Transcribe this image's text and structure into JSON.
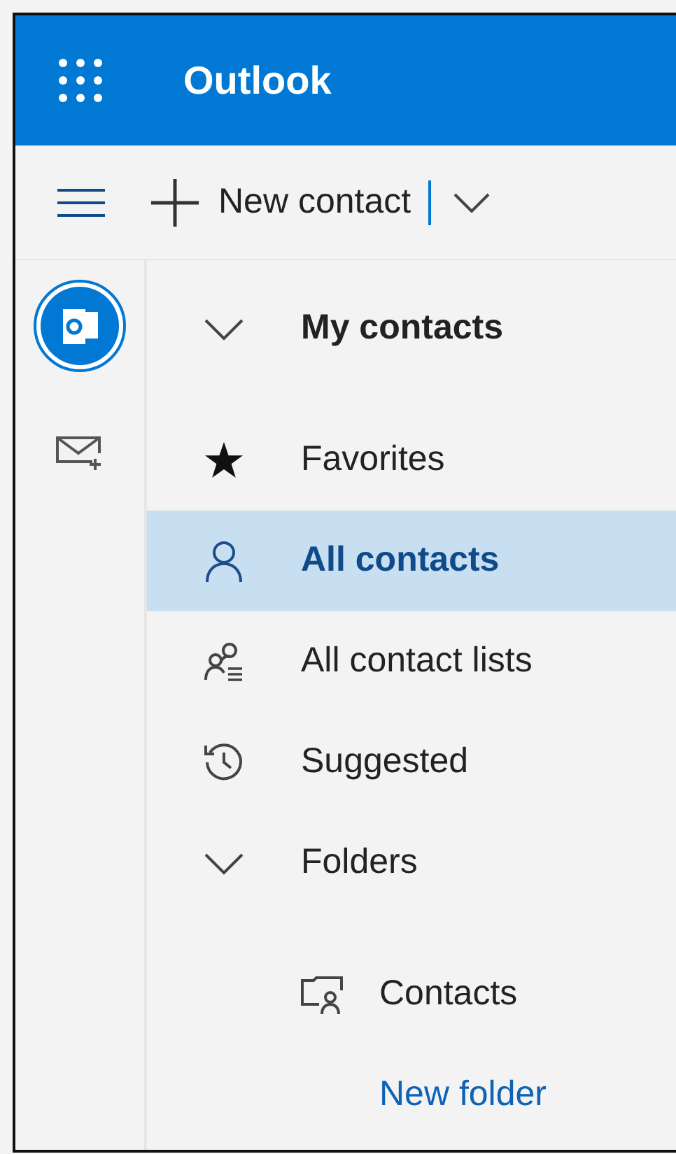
{
  "header": {
    "title": "Outlook"
  },
  "toolbar": {
    "new_contact": "New contact"
  },
  "nav": {
    "title": "My contacts",
    "expanded": true,
    "items": [
      {
        "label": "Favorites",
        "selected": false
      },
      {
        "label": "All contacts",
        "selected": true
      },
      {
        "label": "All contact lists",
        "selected": false
      },
      {
        "label": "Suggested",
        "selected": false
      }
    ],
    "folders": {
      "title": "Folders",
      "expanded": true,
      "children": [
        {
          "label": "Contacts",
          "selected": false
        }
      ],
      "new_folder": "New folder"
    }
  }
}
